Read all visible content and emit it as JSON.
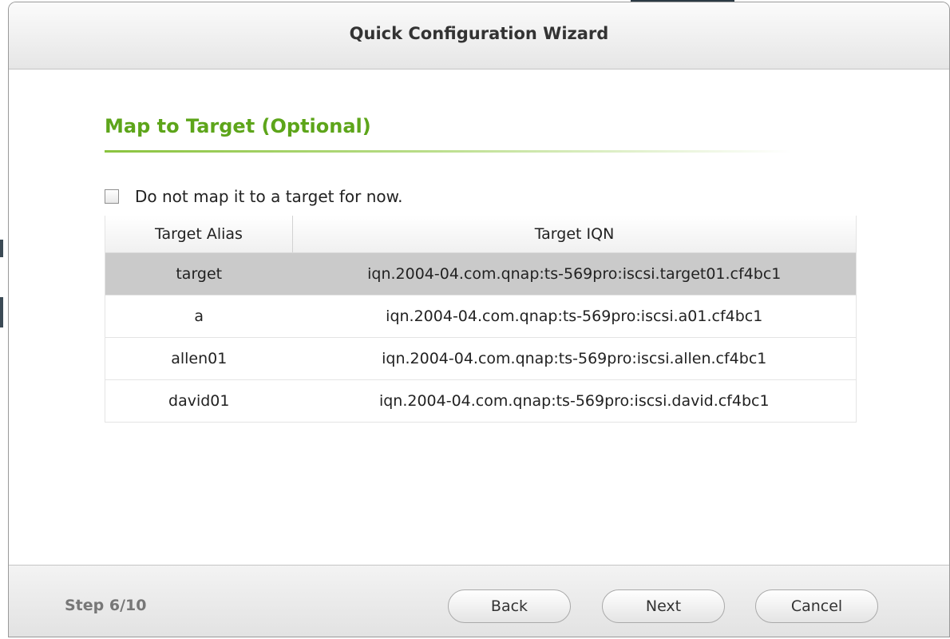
{
  "dialog": {
    "title": "Quick Configuration Wizard"
  },
  "section": {
    "title": "Map to Target (Optional)"
  },
  "option": {
    "label": "Do not map it to a target for now.",
    "checked": false
  },
  "table": {
    "columns": [
      "Target Alias",
      "Target IQN"
    ],
    "rows": [
      {
        "alias": "target",
        "iqn": "iqn.2004-04.com.qnap:ts-569pro:iscsi.target01.cf4bc1",
        "selected": true
      },
      {
        "alias": "a",
        "iqn": "iqn.2004-04.com.qnap:ts-569pro:iscsi.a01.cf4bc1",
        "selected": false
      },
      {
        "alias": "allen01",
        "iqn": "iqn.2004-04.com.qnap:ts-569pro:iscsi.allen.cf4bc1",
        "selected": false
      },
      {
        "alias": "david01",
        "iqn": "iqn.2004-04.com.qnap:ts-569pro:iscsi.david.cf4bc1",
        "selected": false
      }
    ]
  },
  "footer": {
    "step": "Step 6/10",
    "back_label": "Back",
    "next_label": "Next",
    "cancel_label": "Cancel"
  },
  "colors": {
    "accent_green": "#5da51a",
    "selected_row": "#cacaca"
  }
}
